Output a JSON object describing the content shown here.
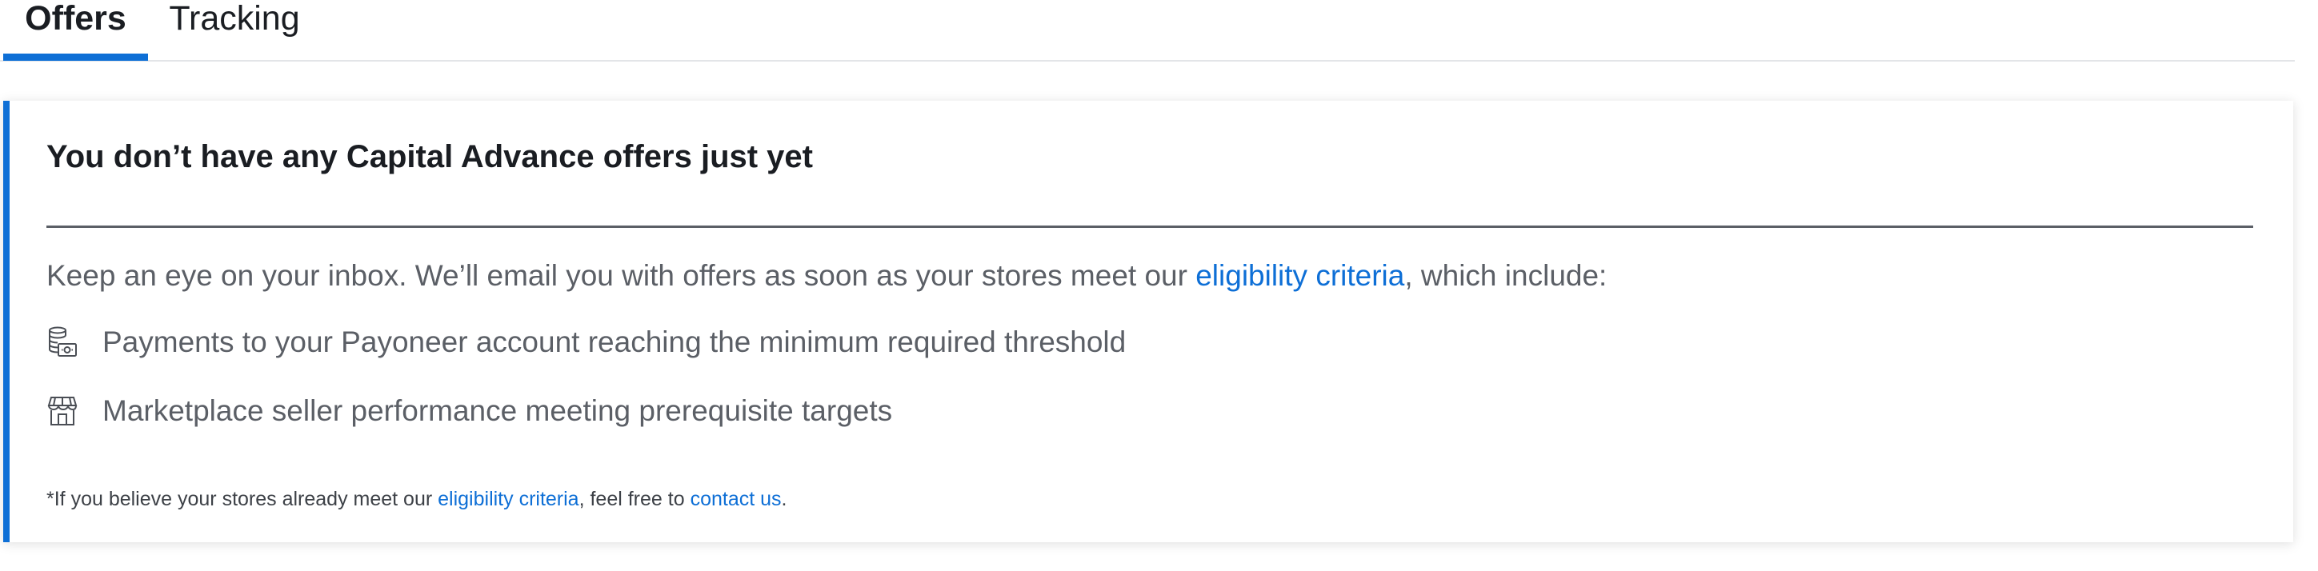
{
  "tabs": {
    "offers": "Offers",
    "tracking": "Tracking"
  },
  "card": {
    "title": "You don’t have any Capital Advance offers just yet",
    "intro_before": "Keep an eye on your inbox. We’ll email you with offers as soon as your stores meet our ",
    "intro_link": "eligibility criteria",
    "intro_after": ", which include:",
    "items": [
      {
        "icon": "coins-banknote-icon",
        "label": "Payments to your Payoneer account reaching the minimum required threshold"
      },
      {
        "icon": "storefront-icon",
        "label": "Marketplace seller performance meeting prerequisite targets"
      }
    ],
    "footnote_before": "*If you believe your stores already meet our ",
    "footnote_link1": "eligibility criteria",
    "footnote_middle": ", feel free to ",
    "footnote_link2": "contact us",
    "footnote_after": "."
  },
  "colors": {
    "accent": "#0e6fd6",
    "text_dark": "#1a1d22",
    "text_muted": "#5b5f66"
  }
}
